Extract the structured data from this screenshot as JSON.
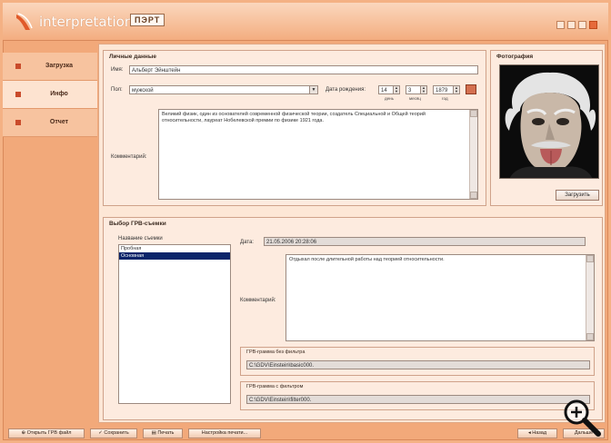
{
  "app": {
    "title": "interpretation",
    "brand": "ПЭРТ",
    "brand_sub": ""
  },
  "sidebar": {
    "items": [
      {
        "label": "Загрузка",
        "active": true
      },
      {
        "label": "Инфо",
        "active": false
      },
      {
        "label": "Отчет",
        "active": false
      }
    ]
  },
  "personal": {
    "legend": "Личные данные",
    "name_label": "Имя:",
    "name_value": "Альберт Эйнштейн",
    "sex_label": "Пол:",
    "sex_value": "мужской",
    "birth_label": "Дата рождения:",
    "birth_day": "14",
    "birth_month": "3",
    "birth_year": "1879",
    "cap_day": "день",
    "cap_month": "месяц",
    "cap_year": "год",
    "comment_label": "Комментарий:",
    "comment_text": "Великий физик, один из основателей современной физической теории, создатель Специальной и Общей теорий относительности, лауреат Нобелевской премии по физике 1921 года."
  },
  "photo": {
    "legend": "Фотография",
    "load_button": "Загрузить"
  },
  "gdv": {
    "legend": "Выбор ГРВ-съемки",
    "list_title": "Название съемки",
    "list_items": [
      "Пробная",
      "Основная"
    ],
    "selected_index": 1,
    "date_label": "Дата:",
    "date_value": "21.05.2006 20:28:06",
    "comment_label": "Комментарий:",
    "comment_text": "Отдыхал после длительной работы над теорией относительности.",
    "without_filter_legend": "ГРВ-грамма без фильтра",
    "without_filter_path": "C:\\GDV\\Einstein\\basic000.",
    "with_filter_legend": "ГРВ-грамма с фильтром",
    "with_filter_path": "C:\\GDV\\Einstein\\filter000."
  },
  "bottom": {
    "open_btn": "Открыть ГРВ файл",
    "save_btn": "Сохранить",
    "print_btn": "Печать",
    "print_settings_btn": "Настройка печати...",
    "back_btn": "Назад",
    "next_btn": "Дальше"
  },
  "colors": {
    "accent": "#f2a97a",
    "panel": "#fde7d6",
    "selection": "#0a246a"
  },
  "icons": [
    "app-logo-icon",
    "minimize-icon",
    "restore-icon",
    "maximize-icon",
    "close-icon",
    "calendar-icon",
    "zoom-icon"
  ]
}
